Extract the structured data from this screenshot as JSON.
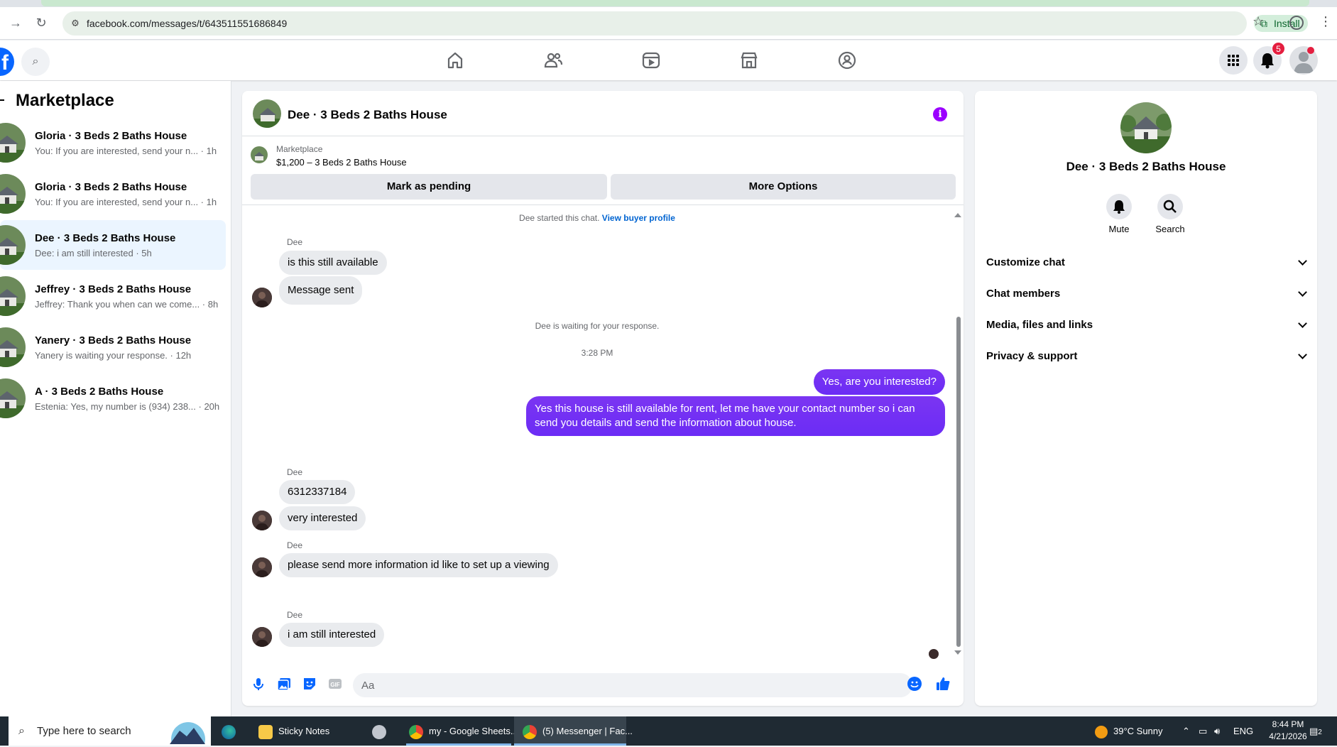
{
  "browser": {
    "url": "facebook.com/messages/t/643511551686849",
    "install_label": "Install"
  },
  "header": {
    "notification_count": "5"
  },
  "sidebar": {
    "title": "Marketplace",
    "conversations": [
      {
        "name": "Gloria · 3 Beds 2 Baths House",
        "preview": "You: If you are interested, send your n... · 1h"
      },
      {
        "name": "Gloria · 3 Beds 2 Baths House",
        "preview": "You: If you are interested, send your n... · 1h"
      },
      {
        "name": "Dee · 3 Beds 2 Baths House",
        "preview": "Dee: i am still interested · 5h"
      },
      {
        "name": "Jeffrey · 3 Beds 2 Baths House",
        "preview": "Jeffrey: Thank you when can we come... · 8h"
      },
      {
        "name": "Yanery · 3 Beds 2 Baths House",
        "preview": "Yanery is waiting your response. · 12h"
      },
      {
        "name": "A · 3 Beds 2 Baths House",
        "preview": "Estenia: Yes, my number is (934) 238... · 20h"
      }
    ]
  },
  "chat": {
    "title": "Dee · 3 Beds 2 Baths House",
    "listing_label": "Marketplace",
    "listing_price": "$1,200 – 3 Beds 2 Baths House",
    "mark_pending": "Mark as pending",
    "more_options": "More Options",
    "started_text": "Dee started this chat.",
    "view_buyer_profile": "View buyer profile",
    "sender": "Dee",
    "msg_available": "is this still available",
    "msg_sent": "Message sent",
    "waiting_text": "Dee is waiting for your response.",
    "time": "3:28 PM",
    "out_1": "Yes, are you interested?",
    "out_2": "Yes this house is still available for rent, let me have your contact number so i can send you details and send the information about house.",
    "msg_phone": "6312337184",
    "msg_very": "very interested",
    "msg_please": "please send more information id like to set up a viewing",
    "msg_still": "i am still interested",
    "composer_placeholder": "Aa"
  },
  "details": {
    "name": "Dee · 3 Beds 2 Baths House",
    "mute": "Mute",
    "search": "Search",
    "sections": [
      "Customize chat",
      "Chat members",
      "Media, files and links",
      "Privacy & support"
    ]
  },
  "taskbar": {
    "search_placeholder": "Type here to search",
    "apps": [
      "Sticky Notes",
      "my - Google Sheets...",
      "(5) Messenger | Fac..."
    ],
    "weather": "39°C  Sunny",
    "lang": "ENG",
    "time": "8:44 PM",
    "date": "4/21/2026",
    "notif_count": "2"
  }
}
